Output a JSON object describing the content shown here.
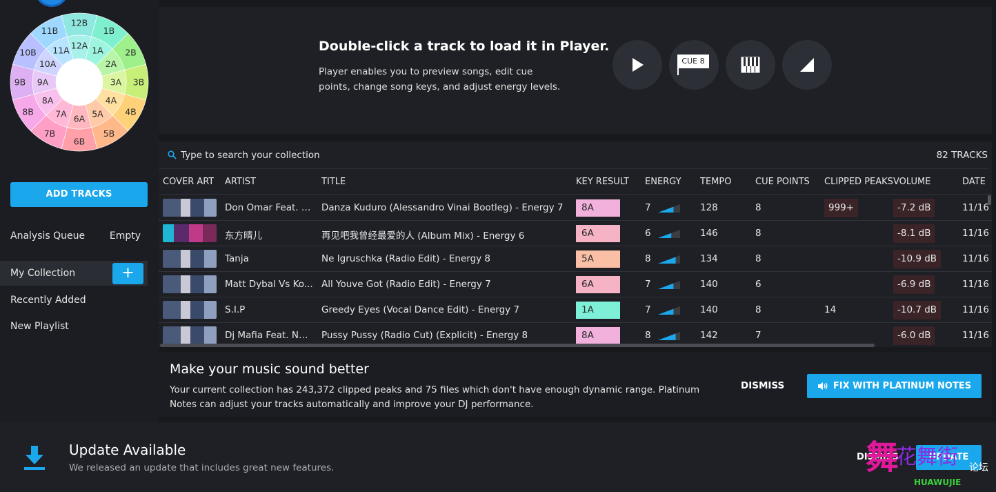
{
  "sidebar": {
    "add_tracks_label": "ADD TRACKS",
    "analysis_queue_label": "Analysis Queue",
    "analysis_queue_status": "Empty",
    "items": [
      {
        "label": "My Collection"
      },
      {
        "label": "Recently Added"
      },
      {
        "label": "New Playlist"
      }
    ],
    "add_playlist_label": "+"
  },
  "camelot_wheel": {
    "outer": [
      "12B",
      "1B",
      "2B",
      "3B",
      "4B",
      "5B",
      "6B",
      "7B",
      "8B",
      "9B",
      "10B",
      "11B"
    ],
    "inner": [
      "12A",
      "1A",
      "2A",
      "3A",
      "4A",
      "5A",
      "6A",
      "7A",
      "8A",
      "9A",
      "10A",
      "11A"
    ]
  },
  "player": {
    "title": "Double-click a track to load it in Player.",
    "description": "Player enables you to preview songs, edit cue points, change song keys, and adjust energy levels.",
    "cue_label": "CUE 8"
  },
  "search": {
    "placeholder": "Type to search your collection",
    "track_count": "82 TRACKS"
  },
  "table": {
    "columns": [
      "COVER ART",
      "ARTIST",
      "TITLE",
      "KEY RESULT",
      "ENERGY",
      "TEMPO",
      "CUE POINTS",
      "CLIPPED PEAKS",
      "VOLUME",
      "DATE"
    ],
    "rows": [
      {
        "artist": "Don Omar Feat. L...",
        "title": "Danza Kuduro (Alessandro Vinai Bootleg) - Energy 7",
        "key": "8A",
        "key_color": "#f2b1dc",
        "energy": "7",
        "energy_level": 0.7,
        "tempo": "128",
        "cue_points": "8",
        "clipped": "999+",
        "volume": "-7.2 dB",
        "date": "11/16"
      },
      {
        "artist": "东方晴儿",
        "title": "再见吧我曾经最爱的人 (Album Mix) - Energy 6",
        "key": "6A",
        "key_color": "#f6b3c6",
        "energy": "6",
        "energy_level": 0.6,
        "tempo": "146",
        "cue_points": "8",
        "clipped": "",
        "volume": "-8.1 dB",
        "date": "11/16"
      },
      {
        "artist": "Tanja",
        "title": "Ne Igruschka (Radio Edit) - Energy 8",
        "key": "5A",
        "key_color": "#fbbfa6",
        "energy": "8",
        "energy_level": 0.8,
        "tempo": "134",
        "cue_points": "8",
        "clipped": "",
        "volume": "-10.9 dB",
        "date": "11/16"
      },
      {
        "artist": "Matt Dybal Vs Ko...",
        "title": "All Youve Got (Radio Edit) - Energy 7",
        "key": "6A",
        "key_color": "#f6b3c6",
        "energy": "7",
        "energy_level": 0.7,
        "tempo": "140",
        "cue_points": "6",
        "clipped": "",
        "volume": "-6.9 dB",
        "date": "11/16"
      },
      {
        "artist": "S.I.P",
        "title": "Greedy Eyes (Vocal Dance Edit) - Energy 7",
        "key": "1A",
        "key_color": "#7ef0d8",
        "energy": "7",
        "energy_level": 0.7,
        "tempo": "140",
        "cue_points": "8",
        "clipped": "14",
        "volume": "-10.7 dB",
        "date": "11/16"
      },
      {
        "artist": "Dj Mafia Feat. Na...",
        "title": "Pussy Pussy (Radio Cut) (Explicit) - Energy 8",
        "key": "8A",
        "key_color": "#f2b1dc",
        "energy": "8",
        "energy_level": 0.8,
        "tempo": "142",
        "cue_points": "7",
        "clipped": "",
        "volume": "-6.0 dB",
        "date": "11/16"
      }
    ]
  },
  "promo": {
    "title": "Make your music sound better",
    "body": "Your current collection has 243,372 clipped peaks and 75 files which don't have enough dynamic range. Platinum Notes can adjust your tracks automatically and improve your DJ performance.",
    "dismiss_label": "DISMISS",
    "fix_label": "FIX WITH PLATINUM NOTES"
  },
  "update": {
    "title": "Update Available",
    "description": "We released an update that includes great new features.",
    "dismiss_label": "DISMISS",
    "update_label": "UPDATE"
  },
  "watermark": {
    "text": "花舞街",
    "sub": "HUAWUJIE",
    "tag": "论坛"
  },
  "colors": {
    "accent": "#1aa7ec",
    "background": "#17191d",
    "panel": "#1e2025"
  }
}
